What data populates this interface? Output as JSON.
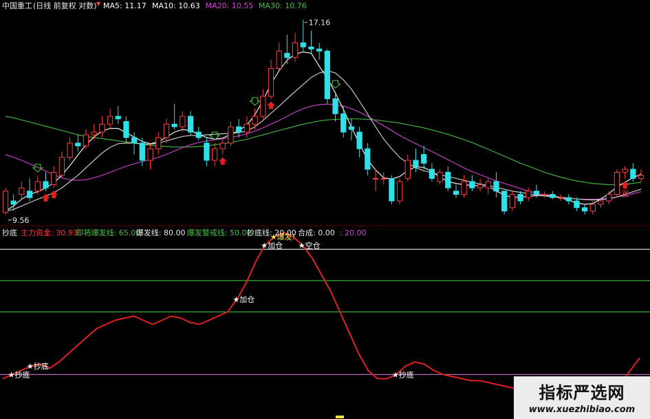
{
  "header": {
    "stock": "中国重工",
    "mode": "(日线 前复权 对数)",
    "ma": [
      {
        "label": "MA5: 11.17",
        "color": "#ffffff"
      },
      {
        "label": "MA10: 10.63",
        "color": "#ffffff"
      },
      {
        "label": "MA20: 10.55",
        "color": "#d040d0"
      },
      {
        "label": "MA30: 10.76",
        "color": "#40c040"
      }
    ]
  },
  "lower_header": {
    "title": "抄底",
    "items": [
      {
        "label": "主力资金: 30.93",
        "color": "#ff3030"
      },
      {
        "label": "即将爆发线: 65.00",
        "color": "#3fc040"
      },
      {
        "label": "爆发线: 80.00",
        "color": "#e8e8e8"
      },
      {
        "label": "爆发警戒线: 50.00",
        "color": "#3fc040"
      },
      {
        "label": "抄底线: 20.00",
        "color": "#e8e8e8"
      },
      {
        "label": "合成: 0.00",
        "color": "#e8e8e8"
      },
      {
        "label": ": 20.00",
        "color": "#d040d0"
      }
    ]
  },
  "price_labels": {
    "high": "17.16",
    "low": "9.56",
    "zhang": "涨"
  },
  "watermark": {
    "title": "指标严选网",
    "url": "www.xuezhibiao.com"
  },
  "colors": {
    "up": "#ff4040",
    "down": "#30e0e8",
    "ma5": "#f0f0f0",
    "ma10": "#c8c8c8",
    "ma20": "#c040c0",
    "ma30": "#40b040",
    "signal": "#e02020"
  },
  "chart_data": [
    {
      "type": "candlestick",
      "ohlc": [
        [
          9.56,
          10.2,
          10.3,
          9.5
        ],
        [
          9.9,
          9.8,
          10.1,
          9.6
        ],
        [
          10.1,
          10.3,
          10.5,
          9.95
        ],
        [
          10.2,
          10.0,
          10.6,
          9.9
        ],
        [
          10.2,
          10.5,
          10.7,
          10.1
        ],
        [
          10.5,
          10.3,
          10.8,
          10.2
        ],
        [
          10.4,
          10.8,
          11.0,
          10.3
        ],
        [
          10.7,
          11.3,
          11.5,
          10.6
        ],
        [
          11.3,
          11.8,
          12.0,
          11.2
        ],
        [
          11.8,
          11.7,
          12.1,
          11.5
        ],
        [
          11.7,
          12.1,
          12.3,
          11.6
        ],
        [
          12.1,
          12.2,
          12.5,
          11.9
        ],
        [
          12.2,
          12.5,
          12.8,
          12.0
        ],
        [
          12.5,
          12.8,
          13.1,
          12.3
        ],
        [
          12.8,
          12.7,
          13.2,
          12.5
        ],
        [
          12.6,
          12.0,
          12.8,
          11.8
        ],
        [
          12.0,
          11.8,
          12.2,
          11.4
        ],
        [
          11.8,
          11.2,
          12.0,
          11.0
        ],
        [
          11.2,
          11.6,
          11.8,
          10.9
        ],
        [
          11.6,
          12.0,
          12.2,
          11.4
        ],
        [
          12.0,
          12.5,
          12.7,
          11.8
        ],
        [
          12.5,
          12.4,
          13.3,
          12.3
        ],
        [
          12.4,
          12.8,
          13.0,
          12.2
        ],
        [
          12.8,
          12.2,
          13.0,
          12.1
        ],
        [
          12.2,
          12.0,
          12.4,
          11.9
        ],
        [
          11.8,
          11.2,
          12.0,
          11.0
        ],
        [
          11.2,
          11.6,
          11.8,
          11.0
        ],
        [
          11.6,
          11.8,
          12.0,
          11.4
        ],
        [
          11.8,
          12.4,
          12.6,
          11.7
        ],
        [
          12.4,
          12.2,
          12.7,
          12.0
        ],
        [
          12.2,
          12.5,
          12.8,
          12.0
        ],
        [
          12.5,
          12.8,
          13.1,
          12.3
        ],
        [
          12.8,
          13.6,
          13.9,
          12.7
        ],
        [
          13.6,
          14.8,
          15.2,
          13.5
        ],
        [
          14.8,
          15.6,
          16.0,
          14.7
        ],
        [
          15.5,
          15.3,
          16.4,
          15.0
        ],
        [
          15.3,
          16.0,
          16.5,
          15.1
        ],
        [
          16.0,
          15.8,
          17.16,
          15.6
        ],
        [
          15.8,
          15.7,
          16.6,
          15.5
        ],
        [
          15.7,
          15.6,
          16.0,
          15.2
        ],
        [
          15.6,
          13.5,
          15.7,
          13.3
        ],
        [
          13.5,
          12.9,
          13.8,
          12.6
        ],
        [
          12.9,
          12.2,
          13.2,
          12.0
        ],
        [
          12.4,
          12.3,
          12.7,
          11.9
        ],
        [
          12.2,
          11.6,
          12.4,
          11.3
        ],
        [
          11.6,
          10.9,
          11.8,
          10.7
        ],
        [
          10.6,
          10.6,
          10.9,
          10.2
        ],
        [
          10.6,
          10.6,
          10.8,
          10.4
        ],
        [
          10.6,
          9.9,
          10.7,
          9.8
        ],
        [
          9.9,
          10.5,
          10.6,
          9.8
        ],
        [
          10.6,
          11.2,
          11.4,
          10.5
        ],
        [
          11.2,
          11.0,
          11.6,
          10.8
        ],
        [
          11.4,
          11.1,
          11.7,
          10.9
        ],
        [
          10.9,
          10.6,
          11.1,
          10.5
        ],
        [
          10.5,
          10.8,
          10.9,
          10.4
        ],
        [
          10.8,
          10.3,
          11.0,
          10.2
        ],
        [
          10.2,
          10.1,
          10.4,
          10.0
        ],
        [
          10.1,
          10.5,
          10.7,
          10.0
        ],
        [
          10.5,
          10.3,
          10.7,
          10.2
        ],
        [
          10.3,
          10.4,
          10.6,
          10.2
        ],
        [
          10.3,
          10.5,
          10.6,
          10.1
        ],
        [
          10.5,
          10.2,
          10.8,
          10.0
        ],
        [
          10.2,
          9.6,
          10.2,
          9.5
        ],
        [
          9.7,
          10.1,
          10.2,
          9.6
        ],
        [
          10.1,
          9.9,
          10.2,
          9.8
        ],
        [
          10.0,
          10.2,
          10.3,
          9.9
        ],
        [
          10.2,
          10.1,
          10.4,
          10.0
        ],
        [
          10.1,
          10.1,
          10.2,
          10.0
        ],
        [
          10.1,
          10.0,
          10.2,
          9.95
        ],
        [
          10.0,
          10.0,
          10.1,
          9.9
        ],
        [
          10.0,
          9.9,
          10.1,
          9.8
        ],
        [
          9.9,
          9.7,
          10.0,
          9.6
        ],
        [
          9.7,
          9.6,
          9.8,
          9.5
        ],
        [
          9.6,
          9.8,
          9.9,
          9.5
        ],
        [
          9.8,
          9.9,
          10.0,
          9.7
        ],
        [
          9.9,
          10.1,
          10.2,
          9.8
        ],
        [
          10.1,
          10.8,
          10.9,
          10.0
        ],
        [
          10.8,
          10.9,
          11.0,
          10.6
        ],
        [
          10.9,
          10.6,
          11.1,
          10.5
        ],
        [
          10.6,
          10.7,
          10.9,
          10.5
        ]
      ],
      "ma5": [
        9.6,
        9.75,
        9.95,
        10.1,
        10.18,
        10.3,
        10.46,
        10.7,
        11.02,
        11.38,
        11.74,
        12.02,
        12.24,
        12.34,
        12.34,
        12.18,
        12.02,
        11.86,
        11.78,
        11.84,
        12.02,
        12.2,
        12.3,
        12.26,
        12.12,
        12.0,
        11.94,
        11.98,
        12.12,
        12.26,
        12.46,
        12.86,
        13.42,
        14.12,
        14.7,
        15.18,
        15.46,
        15.56,
        15.5,
        14.9,
        14.38,
        13.74,
        13.08,
        12.38,
        11.78,
        11.22,
        10.88,
        10.62,
        10.58,
        10.66,
        10.86,
        10.98,
        10.96,
        10.82,
        10.64,
        10.5,
        10.44,
        10.4,
        10.38,
        10.36,
        10.36,
        10.2,
        10.08,
        10.0,
        10.02,
        10.04,
        10.06,
        10.08,
        10.06,
        10.0,
        9.92,
        9.84,
        9.8,
        9.82,
        9.96,
        10.12,
        10.34,
        10.48,
        10.62,
        10.74
      ],
      "ma10": [
        9.6,
        9.65,
        9.75,
        9.85,
        9.95,
        10.05,
        10.15,
        10.3,
        10.5,
        10.7,
        10.95,
        11.2,
        11.45,
        11.65,
        11.78,
        11.8,
        11.8,
        11.78,
        11.76,
        11.8,
        11.88,
        11.96,
        12.04,
        12.08,
        12.08,
        12.1,
        12.12,
        12.14,
        12.16,
        12.18,
        12.24,
        12.4,
        12.64,
        12.92,
        13.2,
        13.5,
        13.8,
        14.1,
        14.4,
        14.6,
        14.7,
        14.6,
        14.3,
        13.9,
        13.4,
        12.9,
        12.4,
        11.95,
        11.6,
        11.3,
        11.1,
        10.95,
        10.85,
        10.78,
        10.72,
        10.66,
        10.6,
        10.54,
        10.48,
        10.42,
        10.38,
        10.32,
        10.26,
        10.2,
        10.16,
        10.12,
        10.08,
        10.05,
        10.03,
        10.01,
        9.99,
        9.96,
        9.94,
        9.93,
        9.94,
        9.96,
        10.02,
        10.1,
        10.18,
        10.26
      ],
      "ma20": [
        11.4,
        11.3,
        11.2,
        11.08,
        10.96,
        10.84,
        10.72,
        10.62,
        10.56,
        10.54,
        10.56,
        10.62,
        10.7,
        10.8,
        10.9,
        11.0,
        11.08,
        11.16,
        11.22,
        11.3,
        11.4,
        11.52,
        11.64,
        11.74,
        11.82,
        11.88,
        11.92,
        11.96,
        12.0,
        12.06,
        12.14,
        12.24,
        12.36,
        12.5,
        12.64,
        12.8,
        12.96,
        13.1,
        13.2,
        13.26,
        13.28,
        13.26,
        13.2,
        13.1,
        12.96,
        12.8,
        12.62,
        12.44,
        12.26,
        12.08,
        11.92,
        11.78,
        11.64,
        11.5,
        11.36,
        11.22,
        11.08,
        10.94,
        10.82,
        10.72,
        10.62,
        10.52,
        10.44,
        10.36,
        10.28,
        10.2,
        10.14,
        10.08,
        10.04,
        10.0,
        9.98,
        9.96,
        9.95,
        9.95,
        9.96,
        9.98,
        10.02,
        10.06,
        10.12,
        10.18
      ],
      "ma30": [
        12.8,
        12.74,
        12.66,
        12.58,
        12.5,
        12.42,
        12.34,
        12.26,
        12.18,
        12.1,
        12.04,
        12.0,
        11.96,
        11.92,
        11.88,
        11.84,
        11.8,
        11.76,
        11.72,
        11.7,
        11.68,
        11.66,
        11.66,
        11.66,
        11.68,
        11.7,
        11.74,
        11.78,
        11.82,
        11.88,
        11.94,
        12.02,
        12.1,
        12.18,
        12.26,
        12.34,
        12.42,
        12.5,
        12.56,
        12.62,
        12.66,
        12.68,
        12.7,
        12.7,
        12.7,
        12.68,
        12.66,
        12.62,
        12.58,
        12.54,
        12.48,
        12.42,
        12.36,
        12.28,
        12.2,
        12.12,
        12.02,
        11.92,
        11.82,
        11.7,
        11.58,
        11.46,
        11.34,
        11.22,
        11.1,
        11.0,
        10.9,
        10.8,
        10.72,
        10.64,
        10.58,
        10.52,
        10.48,
        10.44,
        10.42,
        10.4,
        10.4,
        10.42,
        10.44,
        10.48
      ],
      "signals": [
        {
          "index": 4,
          "kind": "buy-hollow"
        },
        {
          "index": 5,
          "kind": "sell-red"
        },
        {
          "index": 6,
          "kind": "sell-red"
        },
        {
          "index": 26,
          "kind": "buy-hollow"
        },
        {
          "index": 27,
          "kind": "sell-red"
        },
        {
          "index": 31,
          "kind": "buy-hollow"
        },
        {
          "index": 33,
          "kind": "sell-red"
        },
        {
          "index": 41,
          "kind": "buy-hollow"
        },
        {
          "index": 77,
          "kind": "sell-red"
        }
      ]
    },
    {
      "type": "line",
      "name": "主力资金",
      "values": [
        18,
        20,
        22,
        24,
        25,
        23,
        26,
        30,
        34,
        38,
        42,
        44,
        46,
        47,
        48,
        46,
        44,
        46,
        48,
        47,
        45,
        44,
        46,
        48,
        50,
        56,
        64,
        74,
        82,
        86,
        88,
        86,
        82,
        76,
        68,
        60,
        50,
        40,
        30,
        22,
        18,
        18,
        20,
        24,
        26,
        25,
        22,
        20,
        19,
        18,
        17,
        17,
        16,
        15,
        14,
        13,
        12,
        13,
        14,
        15,
        14,
        13,
        12,
        11,
        12,
        14,
        16,
        22,
        28
      ],
      "ylim": [
        0,
        90
      ],
      "reference_lines": [
        {
          "value": 80,
          "color": "#e8e8e8"
        },
        {
          "value": 65,
          "color": "#3fc040"
        },
        {
          "value": 50,
          "color": "#3fc040"
        },
        {
          "value": 20,
          "color": "#d070d0"
        }
      ],
      "annotations": [
        {
          "index": 1,
          "text": "抄底",
          "color": "#ffffff"
        },
        {
          "index": 3,
          "text": "抄底",
          "color": "#ffffff"
        },
        {
          "index": 25,
          "text": "加仓",
          "color": "#ffffff"
        },
        {
          "index": 28,
          "text": "加仓",
          "color": "#ffffff"
        },
        {
          "index": 29,
          "text": "爆发!",
          "color": "#ffe24a"
        },
        {
          "index": 32,
          "text": "空仓",
          "color": "#ffffff"
        },
        {
          "index": 42,
          "text": "抄底",
          "color": "#ffffff"
        },
        {
          "index": 65,
          "text": "抄底",
          "color": "#ffffff"
        }
      ]
    }
  ]
}
